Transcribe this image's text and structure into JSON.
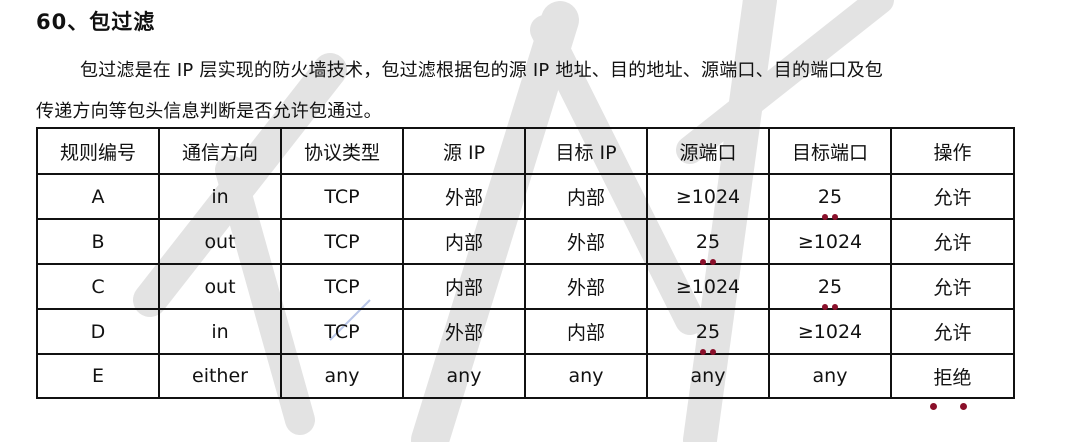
{
  "title": "60、包过滤",
  "paragraph_line1": "包过滤是在 IP 层实现的防火墙技术，包过滤根据包的源 IP 地址、目的地址、源端口、目的端口及包",
  "paragraph_line2": "传递方向等包头信息判断是否允许包通过。",
  "table": {
    "headers": [
      "规则编号",
      "通信方向",
      "协议类型",
      "源 IP",
      "目标 IP",
      "源端口",
      "目标端口",
      "操作"
    ],
    "rows": [
      [
        "A",
        "in",
        "TCP",
        "外部",
        "内部",
        "≥1024",
        "25",
        "允许"
      ],
      [
        "B",
        "out",
        "TCP",
        "内部",
        "外部",
        "25",
        "≥1024",
        "允许"
      ],
      [
        "C",
        "out",
        "TCP",
        "内部",
        "外部",
        "≥1024",
        "25",
        "允许"
      ],
      [
        "D",
        "in",
        "TCP",
        "外部",
        "内部",
        "25",
        "≥1024",
        "允许"
      ],
      [
        "E",
        "either",
        "any",
        "any",
        "any",
        "any",
        "any",
        "拒绝"
      ]
    ]
  },
  "colors": {
    "text": "#111111",
    "emphasis_dot": "#8a0f2a",
    "watermark": "#d9d9d9"
  }
}
